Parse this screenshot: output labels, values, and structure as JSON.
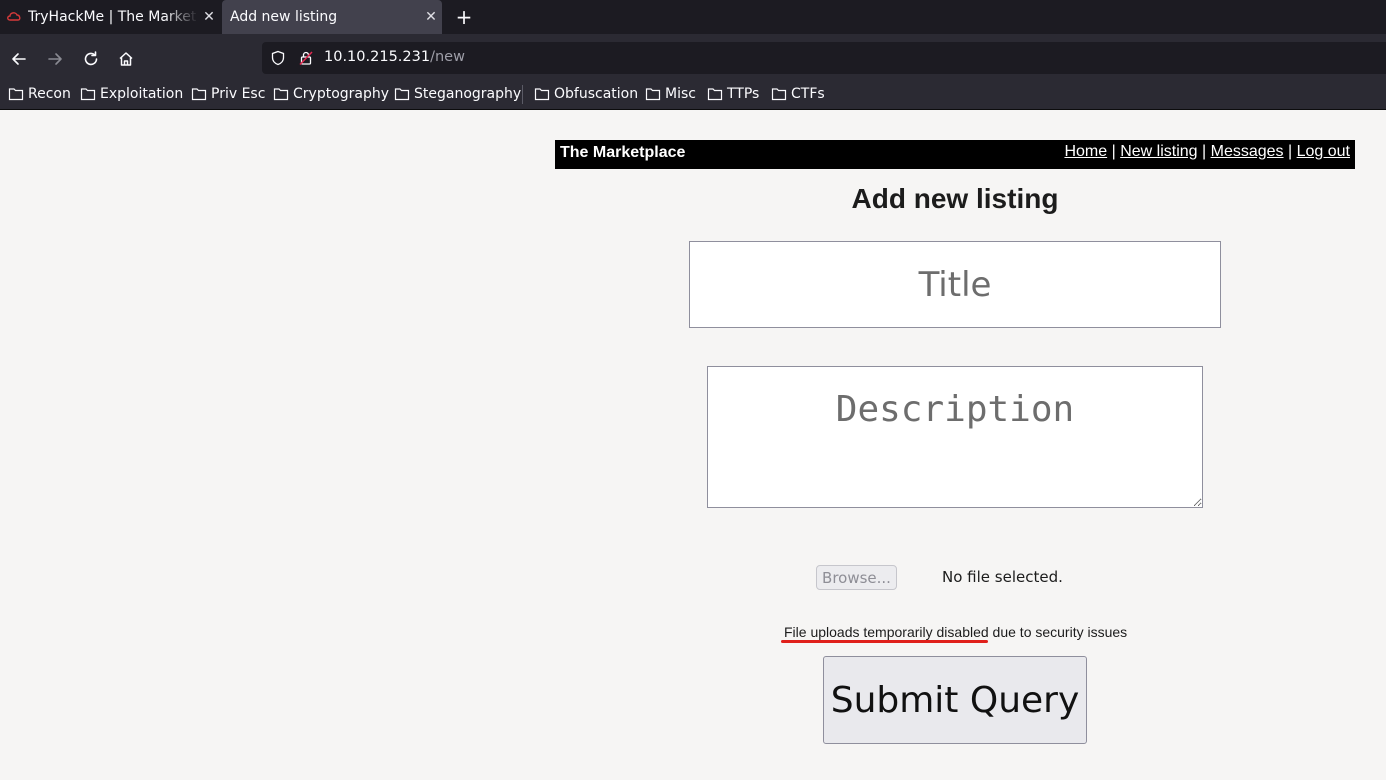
{
  "browser": {
    "tabs": [
      {
        "title": "TryHackMe | The Marketplace",
        "active": false
      },
      {
        "title": "Add new listing",
        "active": true
      }
    ],
    "close_glyph": "✕",
    "new_tab_glyph": "+",
    "url_host": "10.10.215.231",
    "url_path": "/new",
    "bookmarks": [
      {
        "label": "Recon"
      },
      {
        "label": "Exploitation"
      },
      {
        "label": "Priv Esc"
      },
      {
        "label": "Cryptography"
      },
      {
        "label": "Steganography"
      },
      {
        "label": "Obfuscation"
      },
      {
        "label": "Misc"
      },
      {
        "label": "TTPs"
      },
      {
        "label": "CTFs"
      }
    ]
  },
  "site": {
    "name": "The Marketplace",
    "nav": [
      {
        "label": "Home"
      },
      {
        "label": "New listing"
      },
      {
        "label": "Messages"
      },
      {
        "label": "Log out"
      }
    ],
    "nav_separator": "|"
  },
  "form": {
    "heading": "Add new listing",
    "title_placeholder": "Title",
    "description_placeholder": "Description",
    "browse_label": "Browse...",
    "file_status": "No file selected.",
    "notice": "File uploads temporarily disabled due to security issues",
    "submit_label": "Submit Query"
  },
  "colors": {
    "tabbar_bg": "#1c1b22",
    "toolbar_bg": "#2b2a33",
    "page_bg": "#f6f5f4",
    "header_bg": "#000000",
    "annotation_red": "#e0201b"
  }
}
